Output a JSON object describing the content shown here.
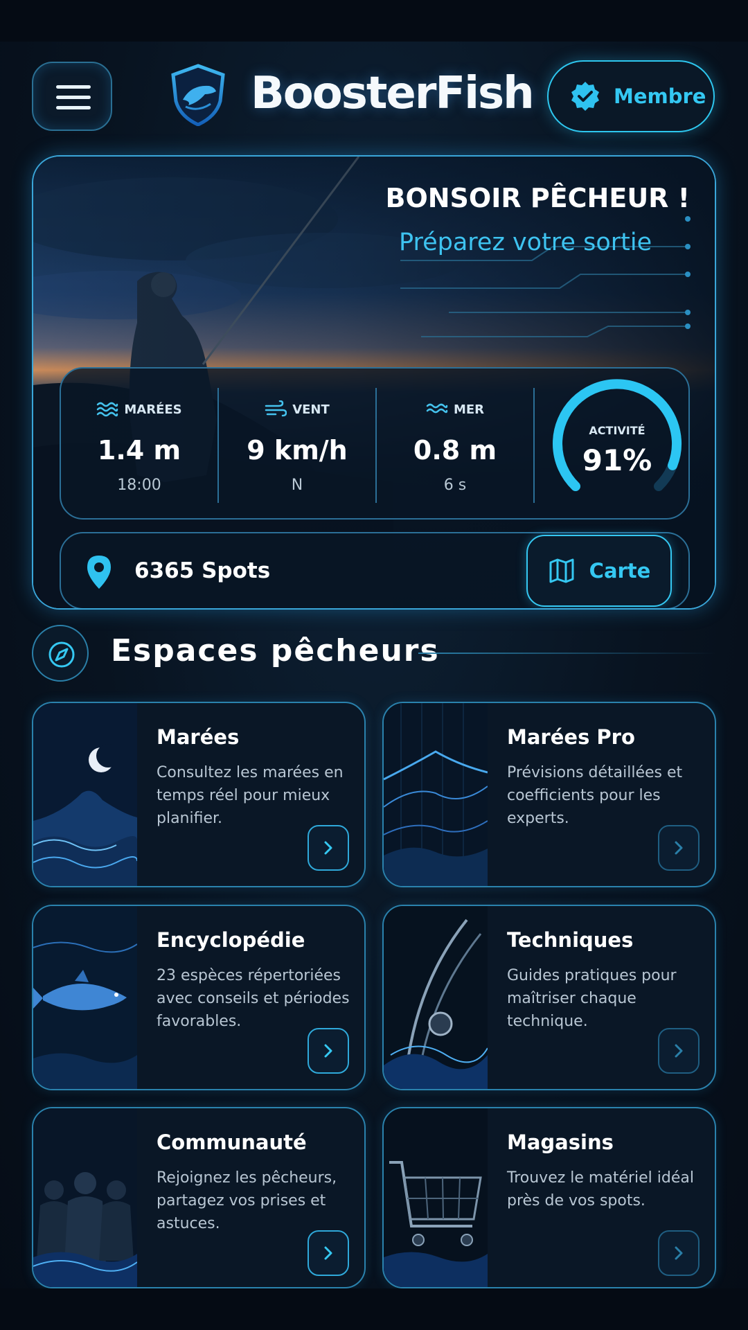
{
  "header": {
    "app_title": "BoosterFish",
    "member_label": "Membre",
    "icons": [
      "menu-icon",
      "logo-shield-icon",
      "verified-badge-icon"
    ]
  },
  "hero": {
    "greeting": "BONSOIR PÊCHEUR !",
    "subtitle": "Préparez votre sortie",
    "stats": [
      {
        "label": "MARÉES",
        "value": "1.4 m",
        "sub": "18:00",
        "icon": "waves-icon"
      },
      {
        "label": "VENT",
        "value": "9 km/h",
        "sub": "N",
        "icon": "wind-icon"
      },
      {
        "label": "MER",
        "value": "0.8 m",
        "sub": "6 s",
        "icon": "sea-icon"
      }
    ],
    "activity": {
      "label": "ACTIVITÉ",
      "value": "91%",
      "percent": 91
    },
    "spots": {
      "count_label": "6365 Spots",
      "map_label": "Carte"
    }
  },
  "section": {
    "title": "Espaces pêcheurs",
    "icon": "compass-icon"
  },
  "cards": [
    {
      "title": "Marées",
      "desc": "Consultez les marées en temps réel pour mieux planifier.",
      "active": true
    },
    {
      "title": "Marées Pro",
      "desc": "Prévisions détaillées et coefficients pour les experts.",
      "active": false
    },
    {
      "title": "Encyclopédie",
      "desc": "23 espèces répertoriées avec conseils et périodes favorables.",
      "active": true
    },
    {
      "title": "Techniques",
      "desc": "Guides pratiques pour maîtriser chaque technique.",
      "active": false
    },
    {
      "title": "Communauté",
      "desc": "Rejoignez les pêcheurs, partagez vos prises et astuces.",
      "active": true
    },
    {
      "title": "Magasins",
      "desc": "Trouvez le matériel idéal près de vos spots.",
      "active": false
    }
  ],
  "colors": {
    "accent": "#35c8f2",
    "background": "#081320",
    "border": "#2a82ad"
  }
}
